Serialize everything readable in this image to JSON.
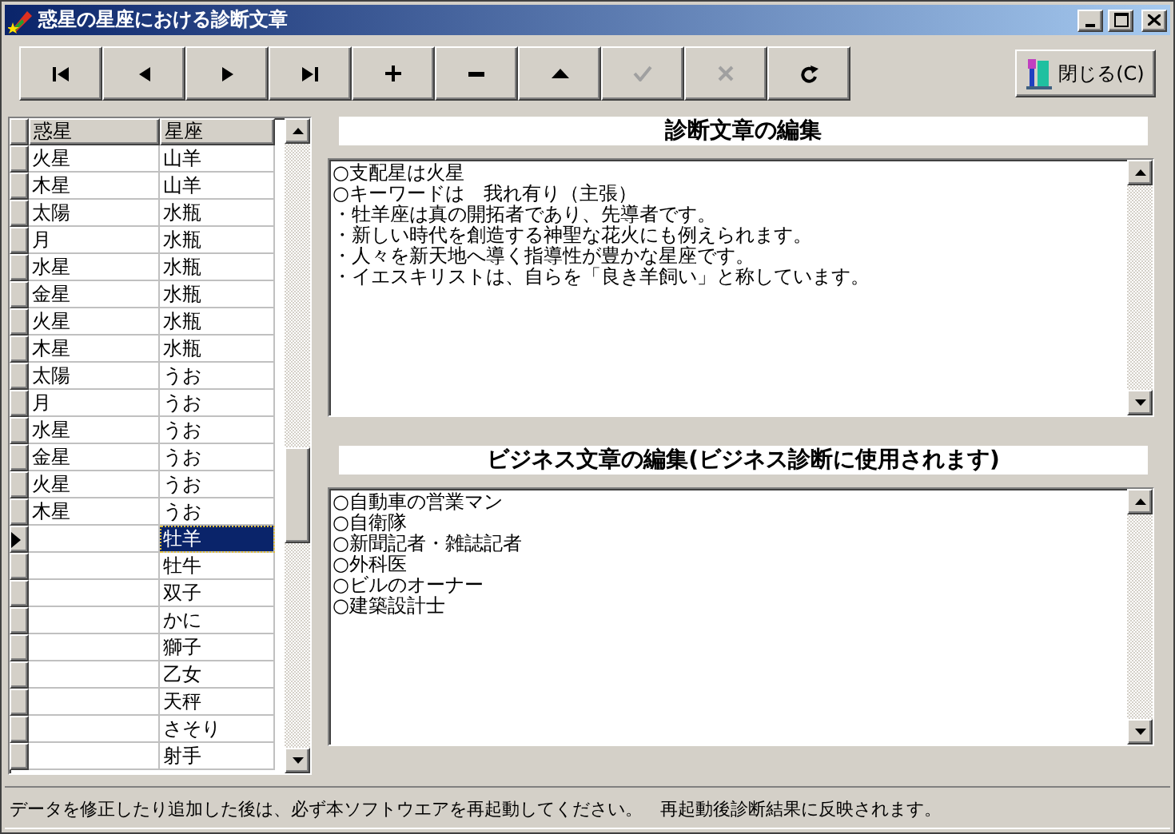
{
  "window": {
    "title": "惑星の星座における診断文章"
  },
  "toolbar": {
    "buttons": [
      {
        "kind": "first",
        "disabled": false
      },
      {
        "kind": "prior",
        "disabled": false
      },
      {
        "kind": "next",
        "disabled": false
      },
      {
        "kind": "last",
        "disabled": false
      },
      {
        "kind": "insert",
        "disabled": false
      },
      {
        "kind": "delete",
        "disabled": false
      },
      {
        "kind": "edit",
        "disabled": false
      },
      {
        "kind": "post",
        "disabled": true
      },
      {
        "kind": "cancel",
        "disabled": true
      },
      {
        "kind": "refresh",
        "disabled": false
      }
    ],
    "close_button": "閉じる(C)"
  },
  "grid": {
    "columns": [
      "惑星",
      "星座"
    ],
    "rows": [
      {
        "planet": "火星",
        "sign": "山羊",
        "selected": false
      },
      {
        "planet": "木星",
        "sign": "山羊",
        "selected": false
      },
      {
        "planet": "太陽",
        "sign": "水瓶",
        "selected": false
      },
      {
        "planet": "月",
        "sign": "水瓶",
        "selected": false
      },
      {
        "planet": "水星",
        "sign": "水瓶",
        "selected": false
      },
      {
        "planet": "金星",
        "sign": "水瓶",
        "selected": false
      },
      {
        "planet": "火星",
        "sign": "水瓶",
        "selected": false
      },
      {
        "planet": "木星",
        "sign": "水瓶",
        "selected": false
      },
      {
        "planet": "太陽",
        "sign": "うお",
        "selected": false
      },
      {
        "planet": "月",
        "sign": "うお",
        "selected": false
      },
      {
        "planet": "水星",
        "sign": "うお",
        "selected": false
      },
      {
        "planet": "金星",
        "sign": "うお",
        "selected": false
      },
      {
        "planet": "火星",
        "sign": "うお",
        "selected": false
      },
      {
        "planet": "木星",
        "sign": "うお",
        "selected": false
      },
      {
        "sign": "牡羊",
        "selected": true
      },
      {
        "sign": "牡牛",
        "selected": false
      },
      {
        "sign": "双子",
        "selected": false
      },
      {
        "sign": "かに",
        "selected": false
      },
      {
        "sign": "獅子",
        "selected": false
      },
      {
        "sign": "乙女",
        "selected": false
      },
      {
        "sign": "天秤",
        "selected": false
      },
      {
        "sign": "さそり",
        "selected": false
      },
      {
        "sign": "射手",
        "selected": false
      }
    ]
  },
  "editors": [
    {
      "heading": "診断文章の編集",
      "lines": [
        "○支配星は火星",
        "○キーワードは　我れ有り（主張）",
        "・牡羊座は真の開拓者であり、先導者です。",
        "・新しい時代を創造する神聖な花火にも例えられます。",
        "・人々を新天地へ導く指導性が豊かな星座です。",
        "・イエスキリストは、自らを「良き羊飼い」と称しています。"
      ]
    },
    {
      "heading": "ビジネス文章の編集(ビジネス診断に使用されます)",
      "lines": [
        "○自動車の営業マン",
        "○自衛隊",
        "○新聞記者・雑誌記者",
        "○外科医",
        "○ビルのオーナー",
        "○建築設計士"
      ]
    }
  ],
  "status_bar": "データを修正したり追加した後は、必ず本ソフトウエアを再起動してください。　再起動後診断結果に反映されます。"
}
